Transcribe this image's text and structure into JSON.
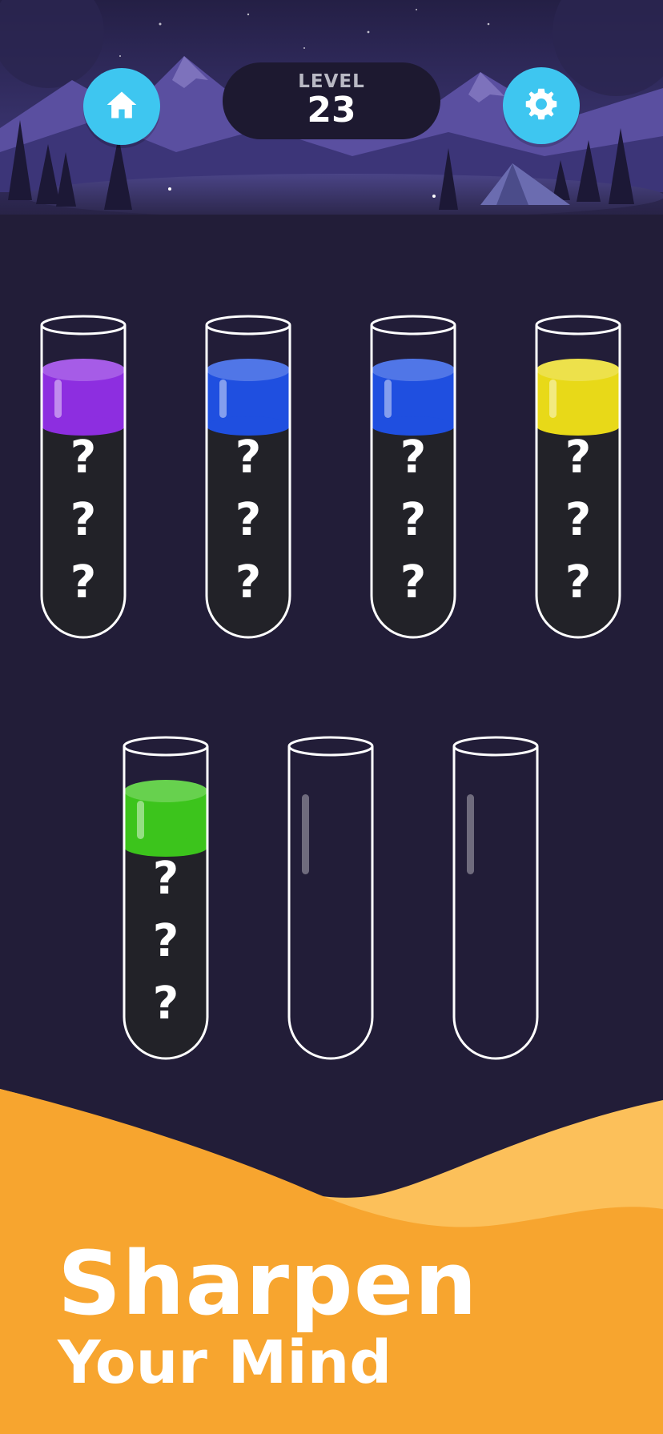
{
  "header": {
    "level_label": "LEVEL",
    "level_number": "23",
    "home_icon": "home-icon",
    "settings_icon": "gear-icon",
    "button_color": "#3ec6f0"
  },
  "colors": {
    "background": "#221d38",
    "tube_dark": "#222228",
    "banner_orange": "#f7a52f",
    "banner_light": "#fcc05a"
  },
  "tubes": [
    {
      "top_color": "#8d2ee0",
      "hidden_count": 3,
      "hidden_label": "?"
    },
    {
      "top_color": "#1f4fe0",
      "hidden_count": 3,
      "hidden_label": "?"
    },
    {
      "top_color": "#1f4fe0",
      "hidden_count": 3,
      "hidden_label": "?"
    },
    {
      "top_color": "#e8d918",
      "hidden_count": 3,
      "hidden_label": "?"
    },
    {
      "top_color": "#3cc41c",
      "hidden_count": 3,
      "hidden_label": "?"
    },
    {
      "top_color": null,
      "hidden_count": 0,
      "hidden_label": "?"
    },
    {
      "top_color": null,
      "hidden_count": 0,
      "hidden_label": "?"
    }
  ],
  "tagline": {
    "line1": "Sharpen",
    "line2": "Your Mind"
  }
}
